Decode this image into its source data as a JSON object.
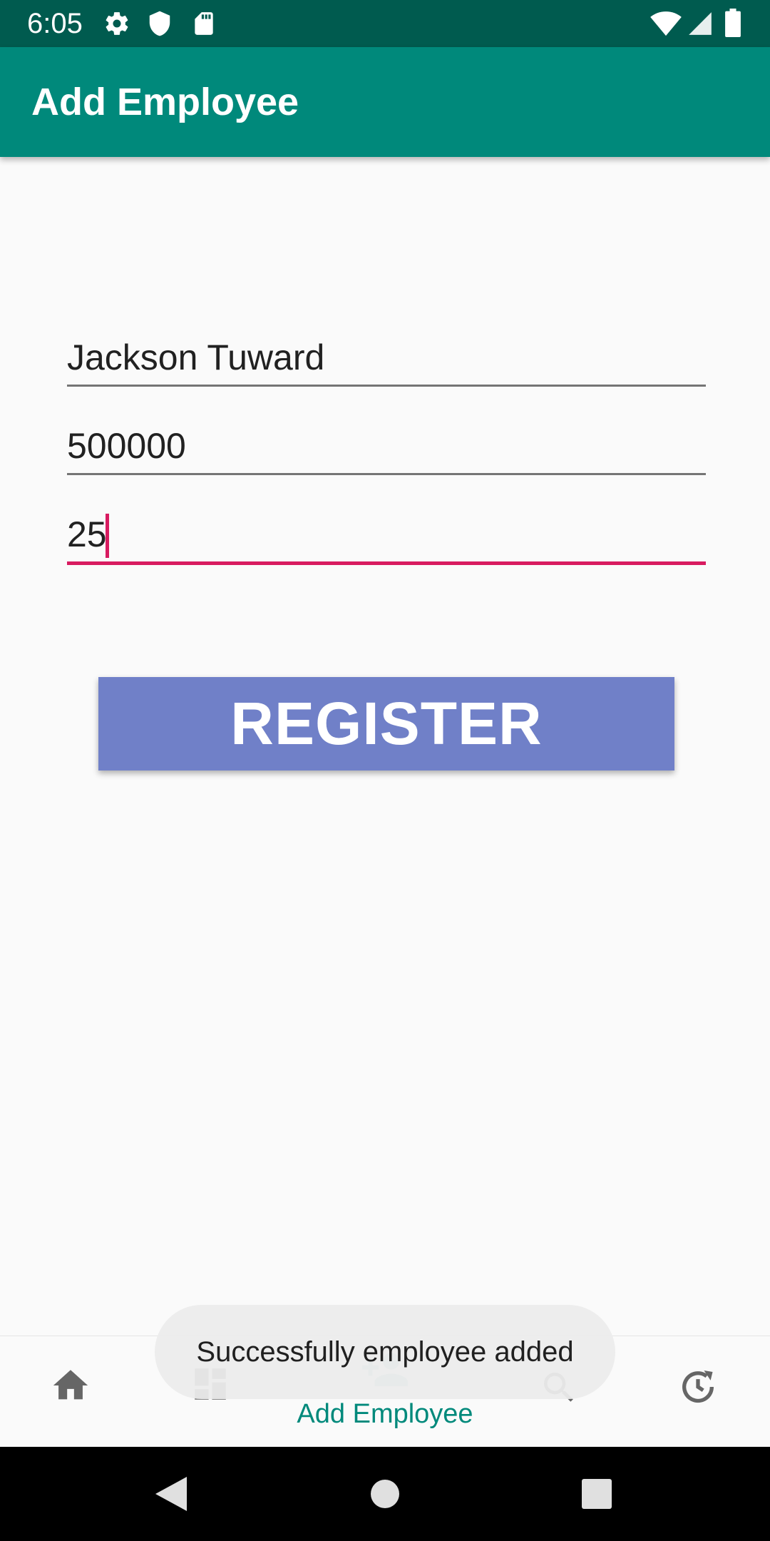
{
  "status_bar": {
    "time": "6:05",
    "icons": [
      "gear-icon",
      "shield-icon",
      "sd-card-icon",
      "wifi-icon",
      "signal-icon",
      "battery-icon"
    ]
  },
  "app_bar": {
    "title": "Add Employee",
    "color": "#00897b"
  },
  "form": {
    "name_value": "Jackson Tuward",
    "salary_value": "500000",
    "age_value": "25",
    "register_label": "REGISTER",
    "accent_color": "#d81b60",
    "button_color": "#7080c8"
  },
  "toast": {
    "message": "Successfully employee added"
  },
  "bottom_nav": {
    "active_label": "Add Employee",
    "items": [
      "home-icon",
      "dashboard-icon",
      "add-user-icon",
      "search-icon",
      "history-icon"
    ]
  },
  "system_nav": [
    "back-icon",
    "home-circle-icon",
    "recents-icon"
  ]
}
